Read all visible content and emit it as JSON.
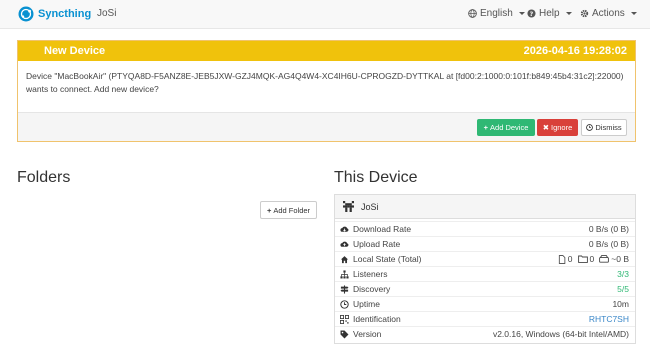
{
  "navbar": {
    "brand": "Syncthing",
    "device_name": "JoSi",
    "language": "English",
    "help": "Help",
    "actions": "Actions"
  },
  "notification": {
    "title": "New Device",
    "timestamp": "2026-04-16 19:28:02",
    "message": "Device \"MacBookAir\" (PTYQA8D-F5ANZ8E-JEB5JXW-GZJ4MQK-AG4Q4W4-XC4IH6U-CPROGZD-DYTTKAL at [fd00:2:1000:0:101f:b849:45b4:31c2]:22000) wants to connect. Add new device?",
    "add_label": "Add Device",
    "ignore_label": "Ignore",
    "dismiss_label": "Dismiss"
  },
  "folders": {
    "heading": "Folders",
    "add_label": "Add Folder"
  },
  "this_device": {
    "heading": "This Device",
    "name": "JoSi",
    "rows": [
      {
        "label": "Download Rate",
        "value": "0 B/s (0 B)",
        "icon": "cloud-download-icon"
      },
      {
        "label": "Upload Rate",
        "value": "0 B/s (0 B)",
        "icon": "cloud-upload-icon"
      },
      {
        "label": "Local State (Total)",
        "files": "0",
        "dirs": "0",
        "size": "~0 B",
        "icon": "home-icon"
      },
      {
        "label": "Listeners",
        "value": "3/3",
        "icon": "sitemap-icon"
      },
      {
        "label": "Discovery",
        "value": "5/5",
        "icon": "signpost-icon"
      },
      {
        "label": "Uptime",
        "value": "10m",
        "icon": "clock-icon"
      },
      {
        "label": "Identification",
        "value": "RHTC7SH",
        "icon": "qrcode-icon"
      },
      {
        "label": "Version",
        "value": "v2.0.16, Windows (64-bit Intel/AMD)",
        "icon": "tag-icon"
      }
    ]
  },
  "colors": {
    "brand": "#0891d1",
    "warning_header": "#f0c20c",
    "success": "#2fb874",
    "danger": "#d9403a",
    "link": "#3a87c8"
  }
}
